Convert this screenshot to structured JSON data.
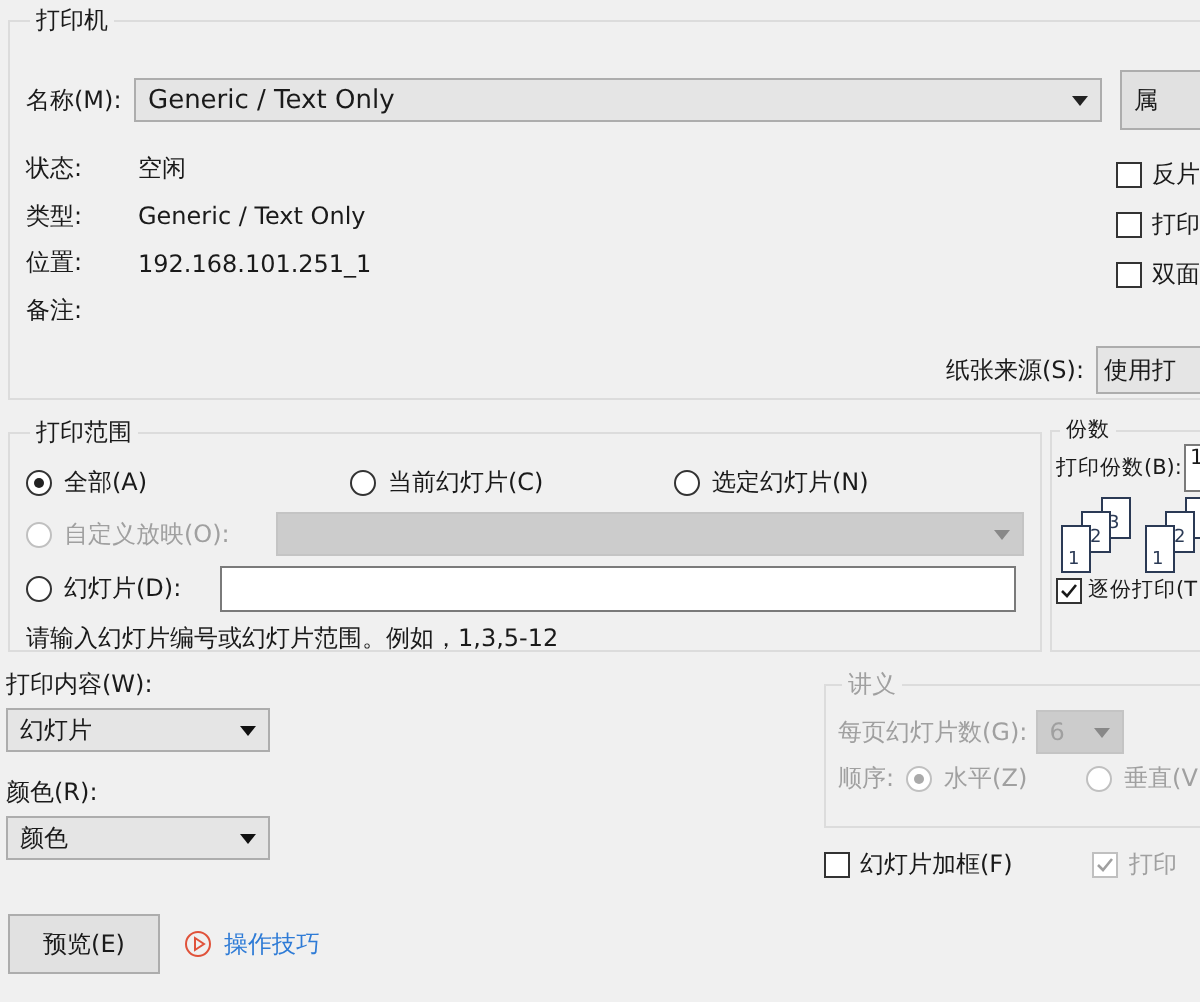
{
  "printer": {
    "title": "打印机",
    "name_label": "名称(M):",
    "name_value": "Generic / Text Only",
    "properties_button": "属",
    "info": [
      {
        "label": "状态:",
        "value": "空闲"
      },
      {
        "label": "类型:",
        "value": "Generic / Text Only"
      },
      {
        "label": "位置:",
        "value": "192.168.101.251_1"
      },
      {
        "label": "备注:"
      }
    ],
    "options": [
      {
        "label": "反片",
        "checked": false
      },
      {
        "label": "打印",
        "checked": false
      },
      {
        "label": "双面",
        "checked": false
      }
    ],
    "paper_source_label": "纸张来源(S):",
    "paper_source_value": "使用打"
  },
  "range": {
    "title": "打印范围",
    "options": [
      {
        "label": "全部(A)",
        "selected": true
      },
      {
        "label": "当前幻灯片(C)",
        "selected": false
      },
      {
        "label": "选定幻灯片(N)",
        "selected": false
      }
    ],
    "custom_show": {
      "label": "自定义放映(O):",
      "selected": false,
      "disabled": true
    },
    "slides": {
      "label": "幻灯片(D):",
      "selected": false
    },
    "hint": "请输入幻灯片编号或幻灯片范围。例如，1,3,5-12"
  },
  "copies": {
    "title": "份数",
    "count_label": "打印份数(B):",
    "count": "1",
    "pages": [
      "1",
      "2",
      "3"
    ],
    "pages_2": [
      "1",
      "2"
    ],
    "collate_label": "逐份打印(T",
    "collate_checked": true
  },
  "print_what": {
    "label": "打印内容(W):",
    "value": "幻灯片"
  },
  "color": {
    "label": "颜色(R):",
    "value": "颜色"
  },
  "handouts": {
    "title": "讲义",
    "disabled": true,
    "per_page_label": "每页幻灯片数(G):",
    "per_page": "6",
    "order_label": "顺序:",
    "orders": [
      {
        "label": "水平(Z)",
        "selected": true
      },
      {
        "label": "垂直(V",
        "selected": false
      }
    ]
  },
  "frame_slides": {
    "label": "幻灯片加框(F)",
    "checked": false
  },
  "print_hidden": {
    "label": "打印",
    "checked": true,
    "disabled": true
  },
  "buttons": {
    "preview": "预览(E)",
    "tips": "操作技巧"
  }
}
